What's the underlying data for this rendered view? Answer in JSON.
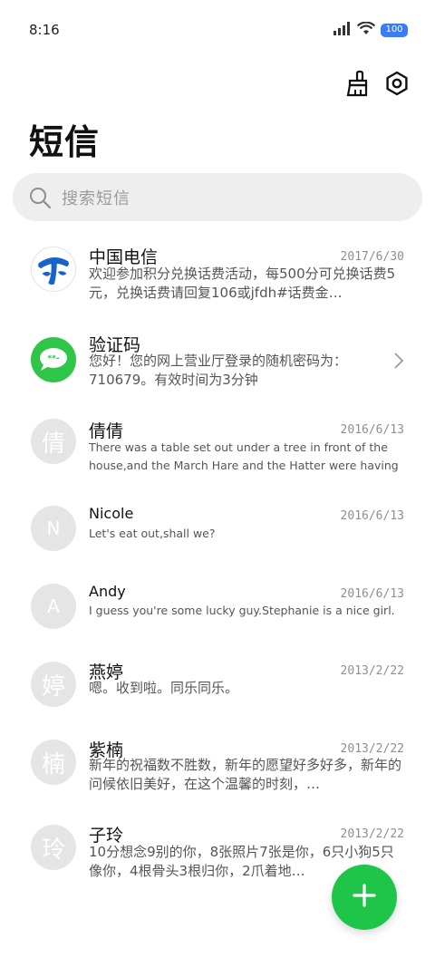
{
  "status_bar": {
    "time": "8:16",
    "battery": "100"
  },
  "header": {
    "title": "短信"
  },
  "search": {
    "placeholder": "搜索短信"
  },
  "conversations": [
    {
      "name": "中国电信",
      "date": "2017/6/30",
      "preview": "欢迎参加积分兑换话费活动，每500分可兑换话费5元，兑换话费请回复106或jfdh#话费金…",
      "avatar_type": "logo-telecom"
    },
    {
      "name": "验证码",
      "date": "",
      "preview": "您好！您的网上营业厅登录的随机密码为：710679。有效时间为3分钟",
      "avatar_type": "logo-verify"
    },
    {
      "name": "倩倩",
      "date": "2016/6/13",
      "preview": "There was a table set out under a tree in front of the house,and the March Hare and the Hatter were having t…",
      "avatar": "倩"
    },
    {
      "name": "Nicole",
      "date": "2016/6/13",
      "preview": "Let's eat out,shall we?",
      "avatar": "N"
    },
    {
      "name": "Andy",
      "date": "2016/6/13",
      "preview": "I guess you're some lucky guy.Stephanie is a nice girl.",
      "avatar": "A"
    },
    {
      "name": "燕婷",
      "date": "2013/2/22",
      "preview": "嗯。收到啦。同乐同乐。",
      "avatar": "婷"
    },
    {
      "name": "紫楠",
      "date": "2013/2/22",
      "preview": "新年的祝福数不胜数，新年的愿望好多好多，新年的问候依旧美好，在这个温馨的时刻，…",
      "avatar": "楠"
    },
    {
      "name": "子玲",
      "date": "2013/2/22",
      "preview": "10分想念9别的你，8张照片7张是你，6只小狗5只像你，4根骨头3根归你，2爪着地…",
      "avatar": "玲"
    }
  ],
  "colors": {
    "accent_green": "#1ec548",
    "telecom_blue": "#1763c7",
    "battery_blue": "#3a7cf5"
  }
}
